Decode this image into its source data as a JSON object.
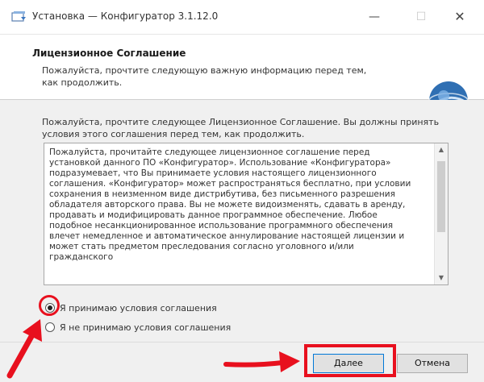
{
  "window": {
    "title": "Установка — Конфигуратор 3.1.12.0",
    "controls": {
      "minimize": "—",
      "maximize": "☐",
      "close": "✕"
    }
  },
  "header": {
    "title": "Лицензионное Соглашение",
    "subtitle": "Пожалуйста, прочтите следующую важную информацию перед тем, как продолжить."
  },
  "content": {
    "intro": "Пожалуйста, прочтите следующее Лицензионное Соглашение. Вы должны принять условия этого соглашения перед тем, как продолжить.",
    "license_text": "Пожалуйста, прочитайте следующее лицензионное соглашение перед установкой данного ПО «Конфигуратор». Использование «Конфигуратора» подразумевает, что Вы принимаете условия настоящего лицензионного соглашения. «Конфигуратор» может распространяться бесплатно, при условии сохранения в неизменном виде дистрибутива, без письменного разрешения обладателя авторского права. Вы не можете видоизменять, сдавать в аренду, продавать и модифицировать данное программное обеспечение. Любое подобное несанкционированное использование программного обеспечения влечет немедленное и автоматическое аннулирование настоящей лицензии и может стать предметом преследования согласно уголовного и/или гражданского",
    "accept_label": "Я принимаю условия соглашения",
    "decline_label": "Я не принимаю условия соглашения",
    "selected": "accept"
  },
  "footer": {
    "next_label": "Далее",
    "cancel_label": "Отмена"
  },
  "colors": {
    "annotation": "#e8101e",
    "accent": "#0078d7"
  }
}
